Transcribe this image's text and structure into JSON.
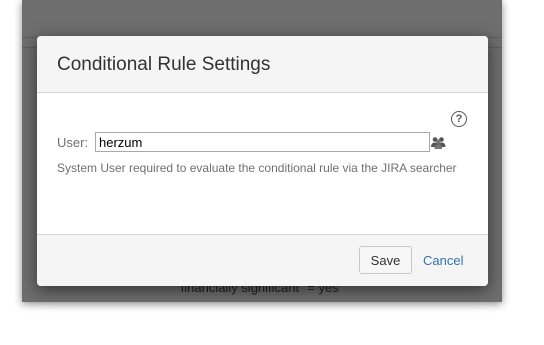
{
  "background": {
    "underlay_text": "\"financially significant\" = yes"
  },
  "dialog": {
    "title": "Conditional Rule Settings",
    "help_icon_glyph": "?",
    "user_field": {
      "label": "User:",
      "value": "herzum",
      "picker_icon": "user-group-icon"
    },
    "description": "System User required to evaluate the conditional rule via the JIRA searcher",
    "footer": {
      "save_label": "Save",
      "cancel_label": "Cancel"
    }
  },
  "colors": {
    "link": "#3572b0",
    "overlay": "#6e6e6e"
  }
}
